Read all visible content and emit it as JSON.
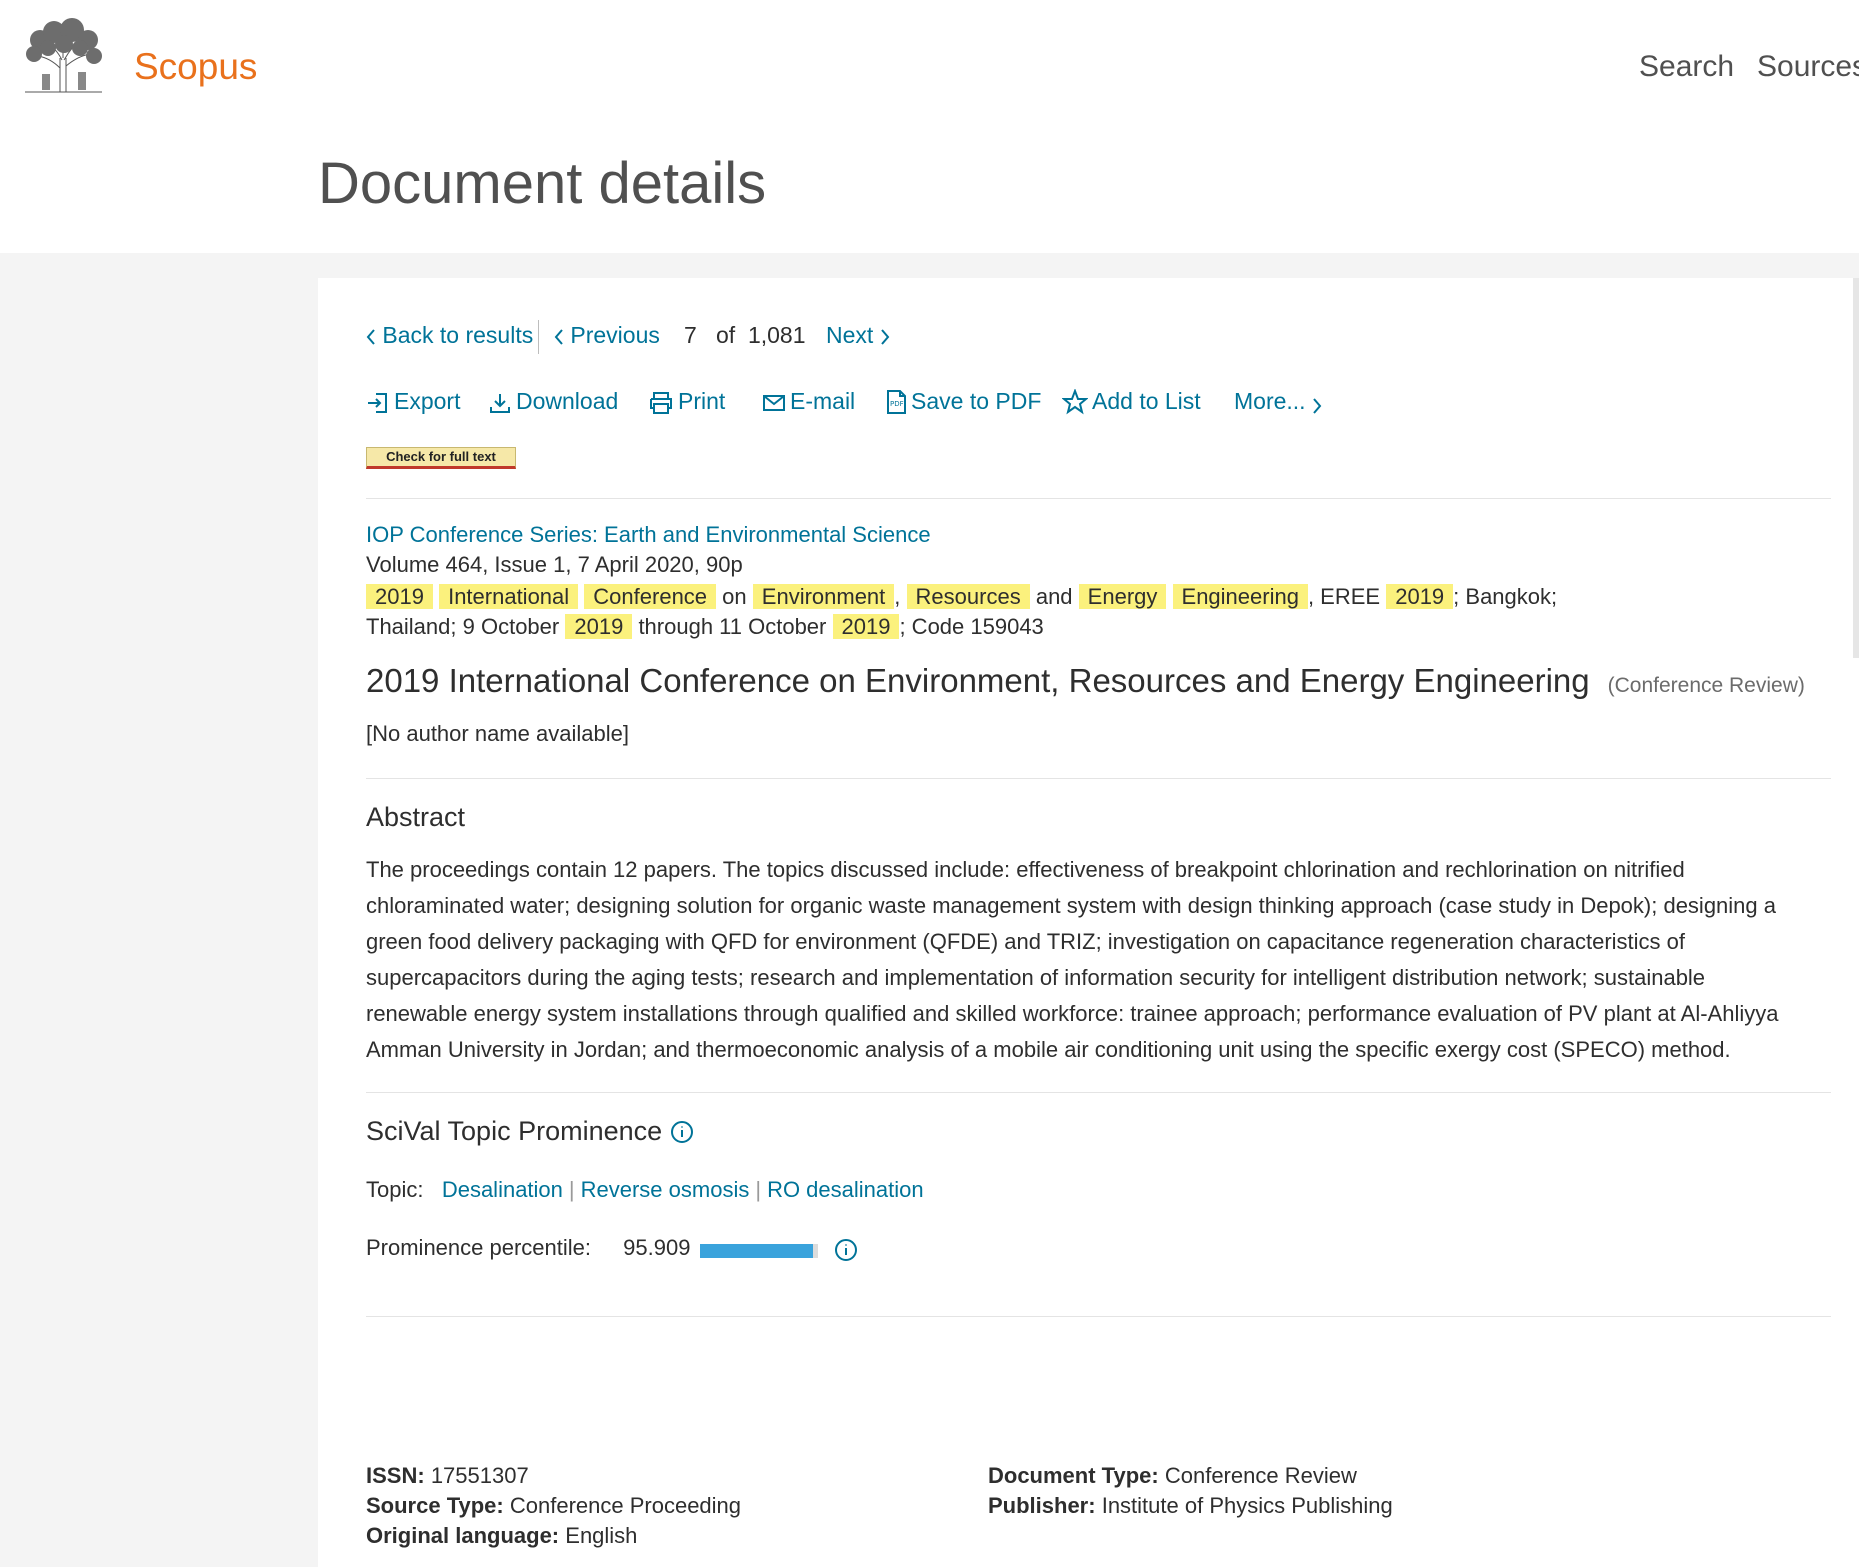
{
  "header": {
    "brand": "Scopus",
    "nav": [
      "Search",
      "Sources"
    ],
    "page_title": "Document details"
  },
  "navigation": {
    "back": "Back to results",
    "previous": "Previous",
    "current": "7",
    "of": "of",
    "total": "1,081",
    "next": "Next"
  },
  "toolbar": {
    "export": "Export",
    "download": "Download",
    "print": "Print",
    "email": "E-mail",
    "save_pdf": "Save to PDF",
    "add_list": "Add to List",
    "more": "More..."
  },
  "fulltext_button": "Check for full text",
  "source": {
    "title": "IOP Conference Series: Earth and Environmental Science",
    "volume": "Volume 464, Issue 1, 7 April 2020, 90p",
    "conference_tokens": [
      {
        "text": "2019",
        "hl": true
      },
      {
        "text": "International",
        "hl": true
      },
      {
        "text": "Conference",
        "hl": true
      },
      {
        "text": "on",
        "hl": false
      },
      {
        "text": "Environment",
        "hl": true
      },
      {
        "text": ",",
        "hl": false
      },
      {
        "text": "Resources",
        "hl": true
      },
      {
        "text": "and",
        "hl": false
      },
      {
        "text": "Energy",
        "hl": true
      },
      {
        "text": "Engineering",
        "hl": true
      },
      {
        "text": ", EREE",
        "hl": false
      },
      {
        "text": "2019",
        "hl": true
      },
      {
        "text": "; Bangkok;",
        "hl": false
      }
    ],
    "conference_tokens_2": [
      {
        "text": "Thailand; 9 October",
        "hl": false
      },
      {
        "text": "2019",
        "hl": true
      },
      {
        "text": "through 11 October",
        "hl": false
      },
      {
        "text": "2019",
        "hl": true
      },
      {
        "text": "; Code 159043",
        "hl": false
      }
    ]
  },
  "document": {
    "title": "2019 International Conference on Environment, Resources and Energy Engineering",
    "type": "(Conference Review)",
    "authors": "[No author name available]"
  },
  "abstract": {
    "heading": "Abstract",
    "text": "The proceedings contain 12 papers. The topics discussed include: effectiveness of breakpoint chlorination and rechlorination on nitrified chloraminated water; designing solution for organic waste management system with design thinking approach (case study in Depok); designing a green food delivery packaging with QFD for environment (QFDE) and TRIZ; investigation on capacitance regeneration characteristics of supercapacitors during the aging tests; research and implementation of information security for intelligent distribution network; sustainable renewable energy system installations through qualified and skilled workforce: trainee approach; performance evaluation of PV plant at Al-Ahliyya Amman University in Jordan; and thermoeconomic analysis of a mobile air conditioning unit using the specific exergy cost (SPECO) method."
  },
  "scival": {
    "heading": "SciVal Topic Prominence",
    "topic_label": "Topic:",
    "topics": [
      "Desalination",
      "Reverse osmosis",
      "RO desalination"
    ],
    "percentile_label": "Prominence percentile:",
    "percentile": "95.909",
    "percentile_fraction": 0.959
  },
  "metadata": {
    "issn_label": "ISSN:",
    "issn": "17551307",
    "source_type_label": "Source Type:",
    "source_type": "Conference Proceeding",
    "language_label": "Original language:",
    "language": "English",
    "doc_type_label": "Document Type:",
    "doc_type": "Conference Review",
    "publisher_label": "Publisher:",
    "publisher": "Institute of Physics Publishing"
  }
}
